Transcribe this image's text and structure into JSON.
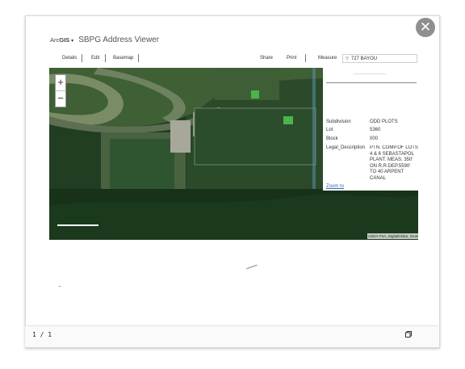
{
  "app": {
    "brand_prefix": "Arc",
    "brand_suffix": "GIS",
    "brand_caret": "▾",
    "title": "SBPG Address Viewer"
  },
  "toolbar": {
    "details": "Details",
    "edit": "Edit",
    "basemap": "Basemap",
    "share": "Share",
    "print": "Print",
    "measure": "Measure",
    "search_icon": "▽",
    "search_value": "727 BAYOU"
  },
  "close_glyph": "✕",
  "zoom": {
    "in": "+",
    "out": "−"
  },
  "attribution": "USDA FSA, DigitalGlobe, GeoE",
  "popup": {
    "rows": [
      {
        "label": "Subdivision",
        "value": "ODD PLOTS"
      },
      {
        "label": "Lot",
        "value": "5360"
      },
      {
        "label": "Block",
        "value": "000"
      },
      {
        "label": "Legal_Description",
        "value": "PTN. COMP.OF LOTS 4 & 6 SEBASTAPOL PLANT. MEAS. 350' ON R.R.DEP.5590' TO 40 ARPENT CANAL"
      }
    ],
    "zoom_to": "Zoom to"
  },
  "footer": {
    "page_count": "1 / 1"
  }
}
